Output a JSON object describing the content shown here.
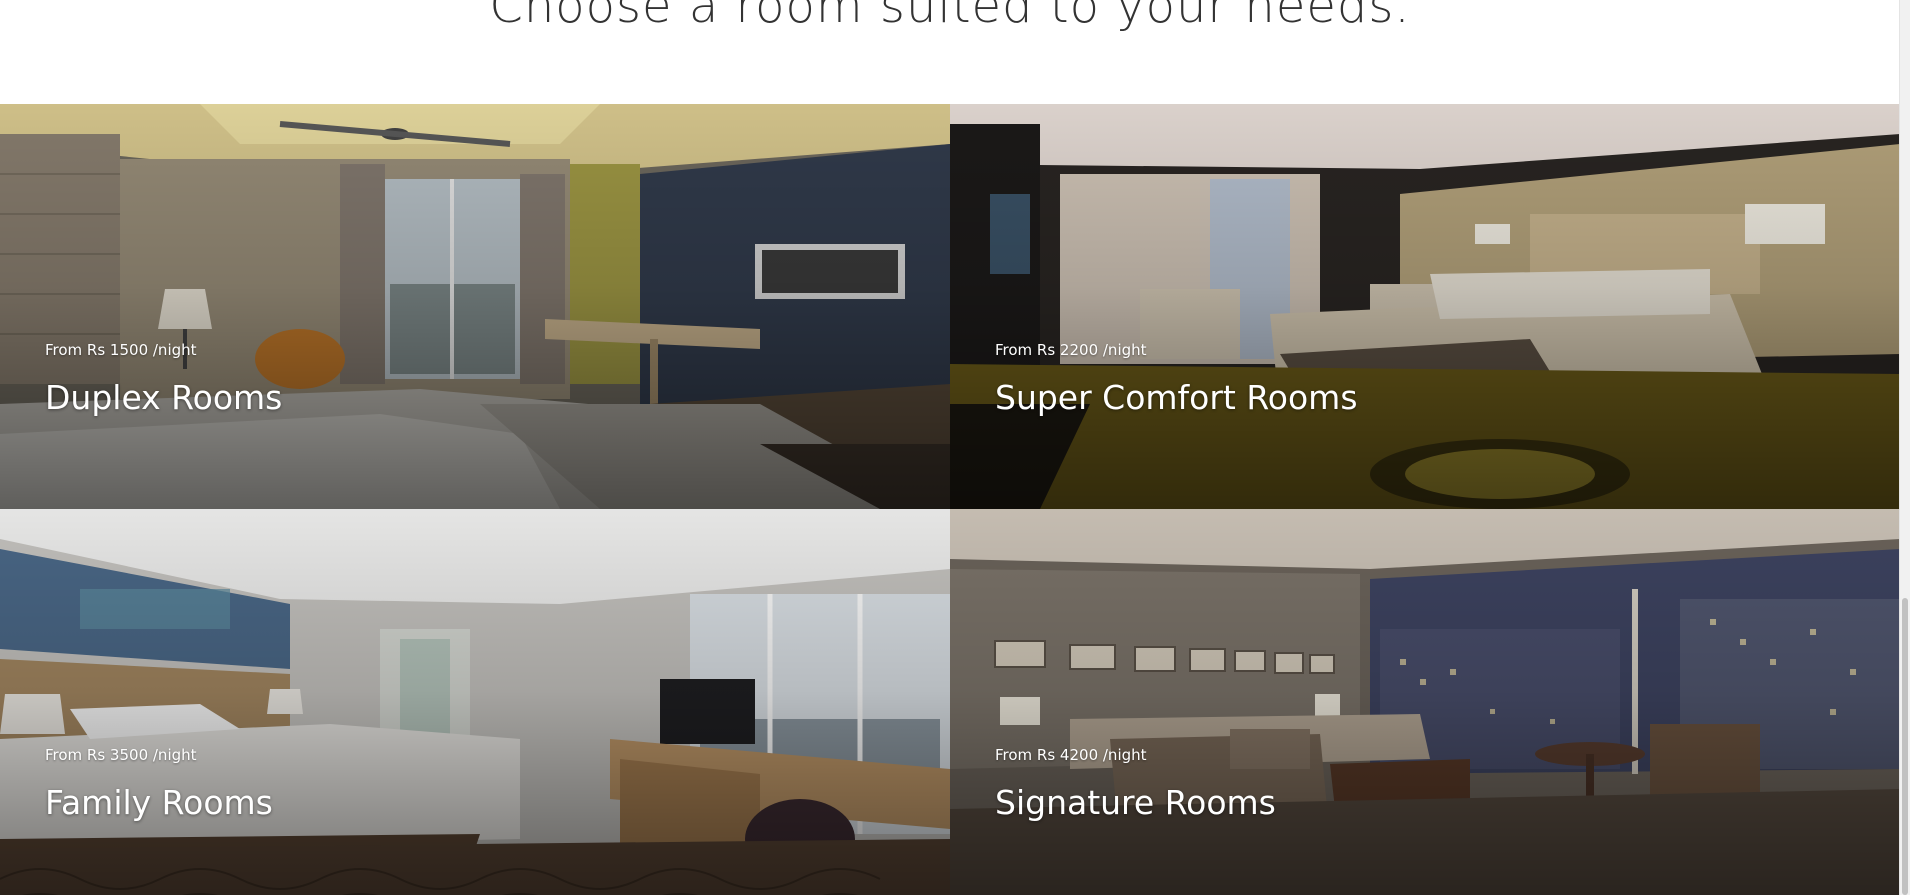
{
  "section": {
    "title": "Choose a room suited to your needs."
  },
  "rooms": [
    {
      "price": "From Rs 1500 /night",
      "name": "Duplex Rooms"
    },
    {
      "price": "From Rs 2200 /night",
      "name": "Super Comfort Rooms"
    },
    {
      "price": "From Rs 3500 /night",
      "name": "Family Rooms"
    },
    {
      "price": "From Rs 4200 /night",
      "name": "Signature Rooms"
    }
  ],
  "colors": {
    "heading_text": "#333333",
    "caption_text": "#ffffff",
    "background": "#ffffff"
  }
}
